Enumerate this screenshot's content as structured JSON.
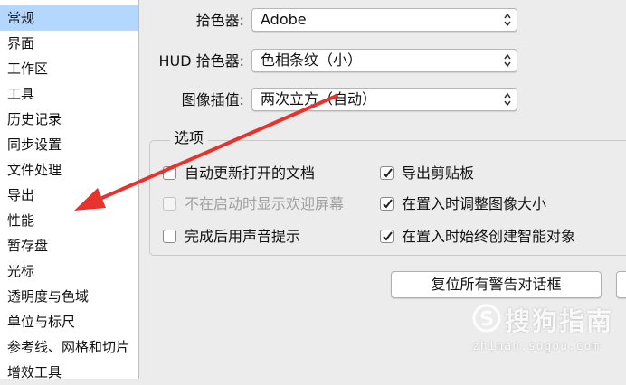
{
  "sidebar": {
    "items": [
      {
        "label": "常规",
        "selected": true
      },
      {
        "label": "界面"
      },
      {
        "label": "工作区"
      },
      {
        "label": "工具"
      },
      {
        "label": "历史记录"
      },
      {
        "label": "同步设置"
      },
      {
        "label": "文件处理"
      },
      {
        "label": "导出"
      },
      {
        "label": "性能"
      },
      {
        "label": "暂存盘"
      },
      {
        "label": "光标"
      },
      {
        "label": "透明度与色域"
      },
      {
        "label": "单位与标尺"
      },
      {
        "label": "参考线、网格和切片"
      },
      {
        "label": "增效工具"
      }
    ]
  },
  "general": {
    "color_picker": {
      "label": "拾色器:",
      "value": "Adobe"
    },
    "hud_color_picker": {
      "label": "HUD 拾色器:",
      "value": "色相条纹（小）"
    },
    "image_interpolation": {
      "label": "图像插值:",
      "value": "两次立方（自动）"
    }
  },
  "options": {
    "title": "选项",
    "checkboxes": [
      {
        "label": "自动更新打开的文档",
        "checked": false,
        "disabled": false
      },
      {
        "label": "不在启动时显示欢迎屏幕",
        "checked": false,
        "disabled": true
      },
      {
        "label": "完成后用声音提示",
        "checked": false,
        "disabled": false
      },
      {
        "label": "导出剪贴板",
        "checked": true,
        "disabled": false
      },
      {
        "label": "在置入时调整图像大小",
        "checked": true,
        "disabled": false
      },
      {
        "label": "在置入时始终创建智能对象",
        "checked": true,
        "disabled": false
      }
    ]
  },
  "buttons": {
    "reset_warnings": "复位所有警告对话框"
  },
  "watermark": {
    "text": "搜狗指南",
    "url": "zhinan.sogou.com"
  },
  "colors": {
    "selection": "#b3d7ff",
    "arrow": "#e8322d",
    "check": "#222222"
  }
}
